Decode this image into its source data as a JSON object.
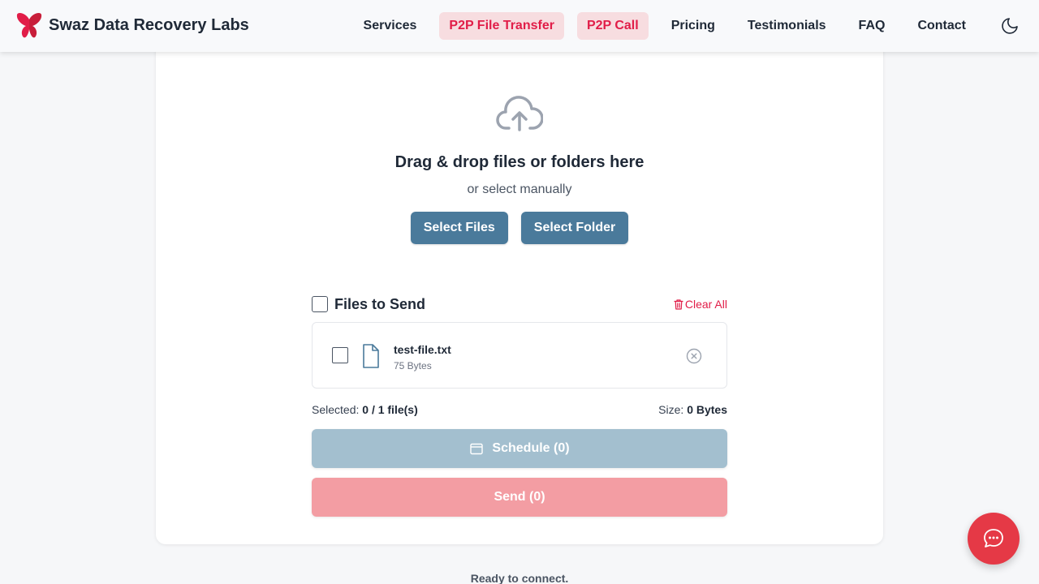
{
  "header": {
    "brand_name": "Swaz Data Recovery Labs",
    "logo_icon": "butterfly-logo",
    "nav": [
      {
        "label": "Services"
      },
      {
        "label": "P2P File Transfer",
        "highlighted": true
      },
      {
        "label": "P2P Call",
        "highlighted": true
      },
      {
        "label": "Pricing"
      },
      {
        "label": "Testimonials"
      },
      {
        "label": "FAQ"
      },
      {
        "label": "Contact"
      }
    ],
    "theme_icon": "moon-icon"
  },
  "drop": {
    "icon": "cloud-upload-icon",
    "title": "Drag & drop files or folders here",
    "subtitle": "or select manually",
    "select_files_label": "Select Files",
    "select_folder_label": "Select Folder"
  },
  "files": {
    "title": "Files to Send",
    "clear_all_label": "Clear All",
    "items": [
      {
        "name": "test-file.txt",
        "size": "75 Bytes",
        "checked": false
      }
    ],
    "selected_label": "Selected:",
    "selected_value": "0 / 1 file(s)",
    "size_label": "Size:",
    "size_value": "0 Bytes"
  },
  "actions": {
    "schedule_label": "Schedule (0)",
    "send_label": "Send (0)"
  },
  "status": "Ready to connect.",
  "chat_icon": "chat-bubble-icon",
  "colors": {
    "accent_red": "#e11d48",
    "highlight_bg": "#f7dde0",
    "button_blue": "#4a7a9b",
    "schedule_disabled": "#a3bfcf",
    "send_disabled": "#f39da3",
    "chat_fab": "#e53946"
  }
}
